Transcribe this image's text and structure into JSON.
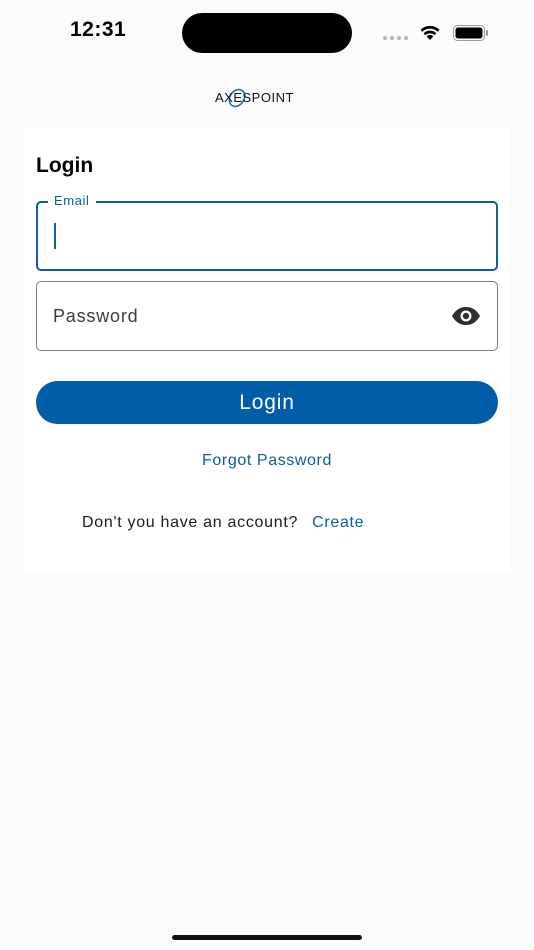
{
  "status_bar": {
    "time": "12:31"
  },
  "brand": {
    "logo_text": "AXESPOINT",
    "accent_color": "#0b5ea8"
  },
  "login_form": {
    "title": "Login",
    "email": {
      "label": "Email",
      "value": ""
    },
    "password": {
      "placeholder": "Password",
      "value": "",
      "toggle_icon": "eye-icon"
    },
    "login_button_label": "Login",
    "forgot_password_label": "Forgot Password",
    "signup_prompt": "Don't you have an account?",
    "create_label": "Create"
  },
  "colors": {
    "primary_button": "#005ea9",
    "link": "#0b5ea8",
    "background": "#fbfbfe"
  }
}
